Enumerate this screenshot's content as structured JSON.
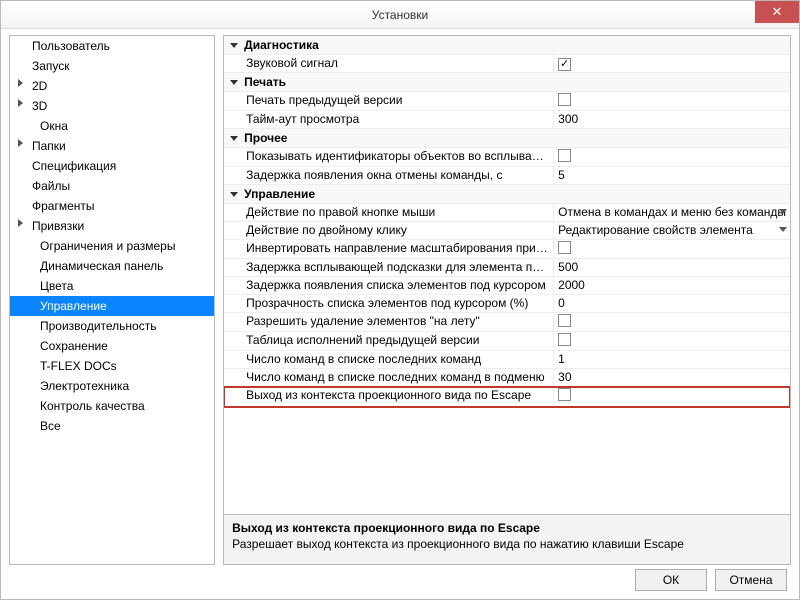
{
  "window": {
    "title": "Установки",
    "close_tooltip": "Закрыть",
    "ok_label": "ОК",
    "cancel_label": "Отмена"
  },
  "tree": {
    "items": [
      {
        "label": "Пользователь",
        "expandable": false,
        "child": false,
        "selected": false
      },
      {
        "label": "Запуск",
        "expandable": false,
        "child": false,
        "selected": false
      },
      {
        "label": "2D",
        "expandable": true,
        "child": false,
        "selected": false
      },
      {
        "label": "3D",
        "expandable": true,
        "child": false,
        "selected": false
      },
      {
        "label": "Окна",
        "expandable": false,
        "child": true,
        "selected": false
      },
      {
        "label": "Папки",
        "expandable": true,
        "child": false,
        "selected": false
      },
      {
        "label": "Спецификация",
        "expandable": false,
        "child": false,
        "selected": false
      },
      {
        "label": "Файлы",
        "expandable": false,
        "child": false,
        "selected": false
      },
      {
        "label": "Фрагменты",
        "expandable": false,
        "child": false,
        "selected": false
      },
      {
        "label": "Привязки",
        "expandable": true,
        "child": false,
        "selected": false
      },
      {
        "label": "Ограничения и размеры",
        "expandable": false,
        "child": true,
        "selected": false
      },
      {
        "label": "Динамическая панель",
        "expandable": false,
        "child": true,
        "selected": false
      },
      {
        "label": "Цвета",
        "expandable": false,
        "child": true,
        "selected": false
      },
      {
        "label": "Управление",
        "expandable": false,
        "child": true,
        "selected": true
      },
      {
        "label": "Производительность",
        "expandable": false,
        "child": true,
        "selected": false
      },
      {
        "label": "Сохранение",
        "expandable": false,
        "child": true,
        "selected": false
      },
      {
        "label": "T-FLEX DOCs",
        "expandable": false,
        "child": true,
        "selected": false
      },
      {
        "label": "Электротехника",
        "expandable": false,
        "child": true,
        "selected": false
      },
      {
        "label": "Контроль качества",
        "expandable": false,
        "child": true,
        "selected": false
      },
      {
        "label": "Все",
        "expandable": false,
        "child": true,
        "selected": false
      }
    ]
  },
  "groups": [
    {
      "name": "Диагностика",
      "rows": [
        {
          "label": "Звуковой сигнал",
          "type": "check",
          "checked": true
        }
      ]
    },
    {
      "name": "Печать",
      "rows": [
        {
          "label": "Печать предыдущей версии",
          "type": "check",
          "checked": false
        },
        {
          "label": "Тайм-аут просмотра",
          "type": "text",
          "value": "300"
        }
      ]
    },
    {
      "name": "Прочее",
      "rows": [
        {
          "label": "Показывать идентификаторы объектов во всплывающей подсказке",
          "type": "check",
          "checked": false
        },
        {
          "label": "Задержка появления окна отмены команды, с",
          "type": "text",
          "value": "5"
        }
      ]
    },
    {
      "name": "Управление",
      "rows": [
        {
          "label": "Действие по правой кнопке мыши",
          "type": "dropdown",
          "value": "Отмена в командах и меню без команды"
        },
        {
          "label": "Действие по двойному клику",
          "type": "dropdown",
          "value": "Редактирование свойств элемента"
        },
        {
          "label": "Инвертировать направление масштабирования при прокрутке",
          "type": "check",
          "checked": false
        },
        {
          "label": "Задержка всплывающей подсказки для элемента под курсором",
          "type": "text",
          "value": "500"
        },
        {
          "label": "Задержка появления списка элементов под курсором",
          "type": "text",
          "value": "2000"
        },
        {
          "label": "Прозрачность списка элементов под курсором (%)",
          "type": "text",
          "value": "0"
        },
        {
          "label": "Разрешить удаление элементов \"на лету\"",
          "type": "check",
          "checked": false
        },
        {
          "label": "Таблица исполнений предыдущей версии",
          "type": "check",
          "checked": false
        },
        {
          "label": "Число команд в списке последних команд",
          "type": "text",
          "value": "1"
        },
        {
          "label": "Число команд в списке последних команд в подменю",
          "type": "text",
          "value": "30"
        },
        {
          "label": "Выход из контекста проекционного вида по Escape",
          "type": "check",
          "checked": false,
          "highlight": true
        }
      ]
    }
  ],
  "description": {
    "title": "Выход из контекста проекционного вида по Escape",
    "text": "Разрешает выход контекста из проекционного вида по нажатию клавиши Escape"
  }
}
